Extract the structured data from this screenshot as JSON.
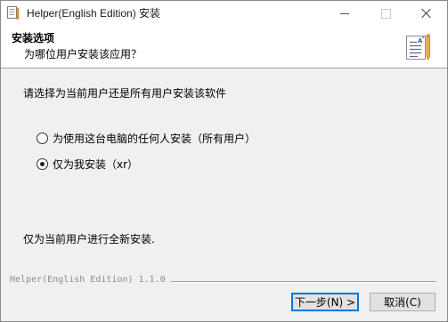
{
  "window": {
    "title": "Helper(English Edition) 安装"
  },
  "header": {
    "title": "安装选项",
    "subtitle": "为哪位用户安装该应用？"
  },
  "main": {
    "prompt": "请选择为当前用户还是所有用户安装该软件",
    "options": [
      {
        "label": "为使用这台电脑的任何人安装（所有用户）",
        "selected": false
      },
      {
        "label": "仅为我安装（xr）",
        "selected": true
      }
    ],
    "status": "仅为当前用户进行全新安装."
  },
  "footer": {
    "brand": "Helper(English Edition) 1.1.0",
    "next_label": "下一步(N) >",
    "cancel_label": "取消(C)"
  },
  "colors": {
    "accent": "#0078d7",
    "dialog_bg": "#f0f0f0",
    "banner_bg": "#ffffff"
  },
  "icons": {
    "app": "installer-app-icon",
    "header": "document-pencil-icon",
    "minimize": "minimize-icon",
    "maximize": "maximize-icon",
    "close": "close-icon"
  }
}
